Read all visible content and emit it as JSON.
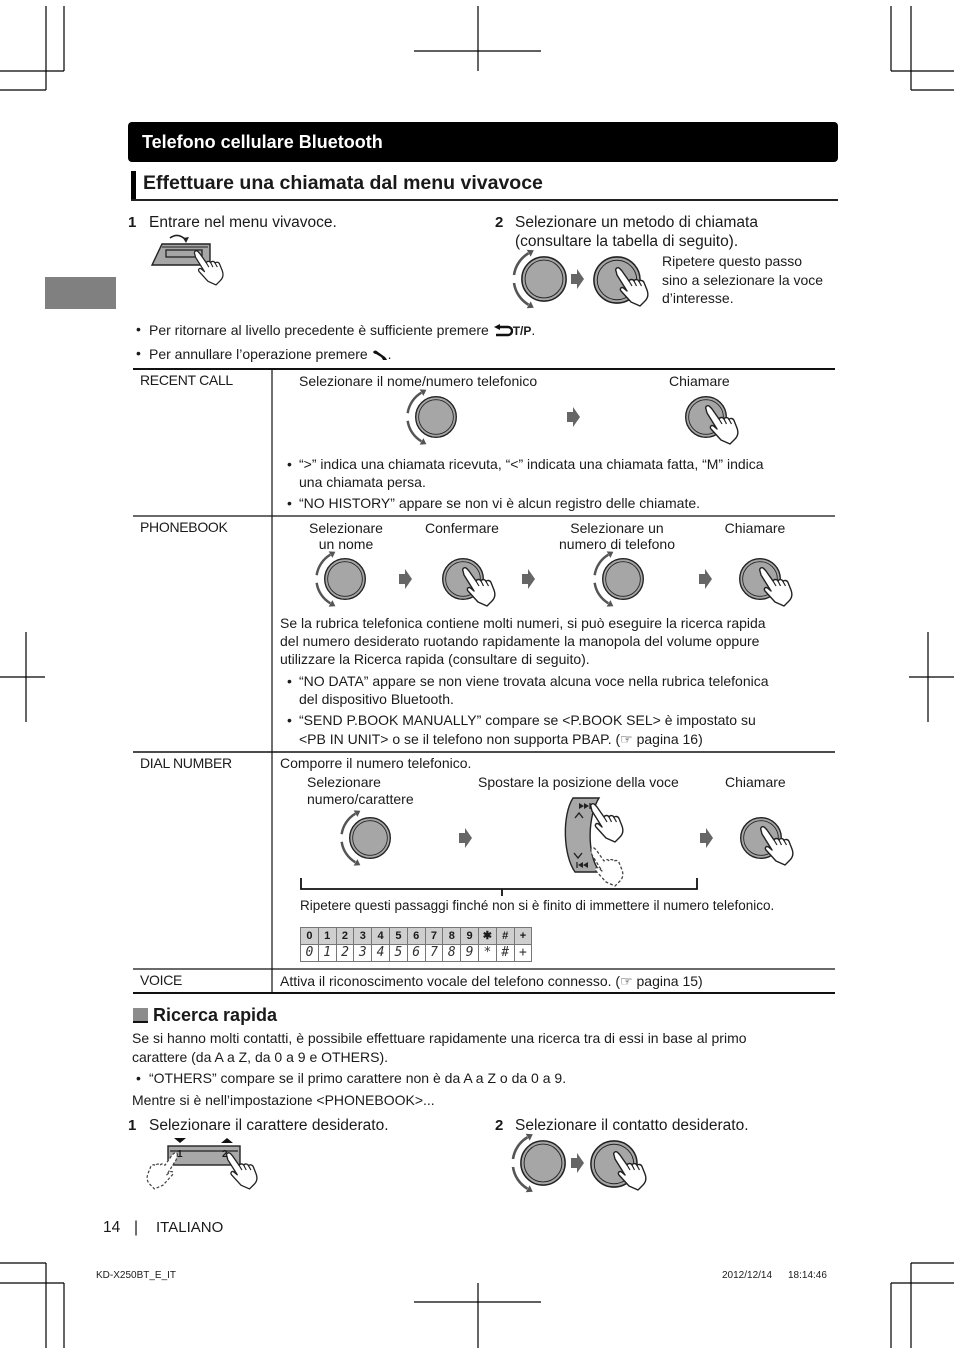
{
  "section_bar": "Telefono cellulare Bluetooth",
  "title": "Effettuare una chiamata dal menu vivavoce",
  "step1": {
    "num": "1",
    "text": "Entrare nel menu vivavoce."
  },
  "step2": {
    "num": "2",
    "lines": [
      "Selezionare un metodo di chiamata",
      "(consultare la tabella di seguito)."
    ],
    "note": [
      "Ripetere questo passo",
      "sino a selezionare la voce",
      "d’interesse."
    ]
  },
  "tips": {
    "back": {
      "text": "Per ritornare al livello precedente è sufficiente premere",
      "key": "T/P",
      "end": "."
    },
    "cancel": {
      "text": "Per annullare l’operazione premere",
      "end": "."
    },
    "bullet": "•"
  },
  "table": {
    "recent_call": {
      "label": "RECENT CALL",
      "steps": [
        "Selezionare il nome/numero telefonico",
        "Chiamare"
      ],
      "bullets": [
        [
          "“>” indica una chiamata ricevuta, “<” indicata una chiamata fatta, “M” indica",
          "una chiamata persa."
        ],
        [
          "“NO HISTORY” appare se non vi è alcun registro delle chiamate."
        ]
      ]
    },
    "phonebook": {
      "label": "PHONEBOOK",
      "steps": [
        [
          "Selezionare",
          "un nome"
        ],
        [
          "Confermare"
        ],
        [
          "Selezionare un",
          "numero di telefono"
        ],
        [
          "Chiamare"
        ]
      ],
      "paragraph": [
        "Se la rubrica telefonica contiene molti numeri, si può eseguire la ricerca rapida",
        "del numero desiderato ruotando rapidamente la manopola del volume oppure",
        "utilizzare la Ricerca rapida (consultare di seguito)."
      ],
      "bullets": [
        [
          "“NO DATA” appare se non viene trovata alcuna voce nella rubrica telefonica",
          "del dispositivo Bluetooth."
        ],
        [
          "“SEND P.BOOK MANUALLY” compare se <P.BOOK SEL> è impostato su",
          "<PB IN UNIT> o se il telefono non supporta PBAP. (☞ pagina 16)"
        ]
      ]
    },
    "dial_number": {
      "label": "DIAL NUMBER",
      "intro": "Comporre il numero telefonico.",
      "steps": [
        [
          "Selezionare",
          "numero/carattere"
        ],
        [
          "Spostare la posizione della voce"
        ],
        [
          "Chiamare"
        ]
      ],
      "repeat_note": "Ripetere questi passaggi finché non si è finito di immettere il numero telefonico.",
      "keys": [
        "0",
        "1",
        "2",
        "3",
        "4",
        "5",
        "6",
        "7",
        "8",
        "9",
        "✱",
        "#",
        "+"
      ],
      "display": [
        "0",
        "1",
        "2",
        "3",
        "4",
        "5",
        "6",
        "7",
        "8",
        "9",
        "*",
        "#",
        "+"
      ]
    },
    "voice": {
      "label": "VOICE",
      "text": "Attiva il riconoscimento vocale del telefono connesso. (☞ pagina 15)"
    }
  },
  "quick_search": {
    "heading": "Ricerca rapida",
    "paragraph": [
      "Se si hanno molti contatti, è possibile effettuare rapidamente una ricerca tra di essi in base al primo",
      "carattere (da A a Z, da 0 a 9 e OTHERS)."
    ],
    "bullet": "“OTHERS” compare se il primo carattere non è da A a Z o da 0 a 9.",
    "context": "Mentre si è nell’impostazione <PHONEBOOK>...",
    "step1": {
      "num": "1",
      "text": "Selezionare il carattere desiderato.",
      "button_labels": [
        "1",
        "2"
      ]
    },
    "step2": {
      "num": "2",
      "text": "Selezionare il contatto desiderato."
    }
  },
  "footer": {
    "page": "14",
    "separator": "|",
    "language": "ITALIANO",
    "doc_code": "KD-X250BT_E_IT",
    "date": "2012/12/14",
    "time": "18:14:46"
  }
}
